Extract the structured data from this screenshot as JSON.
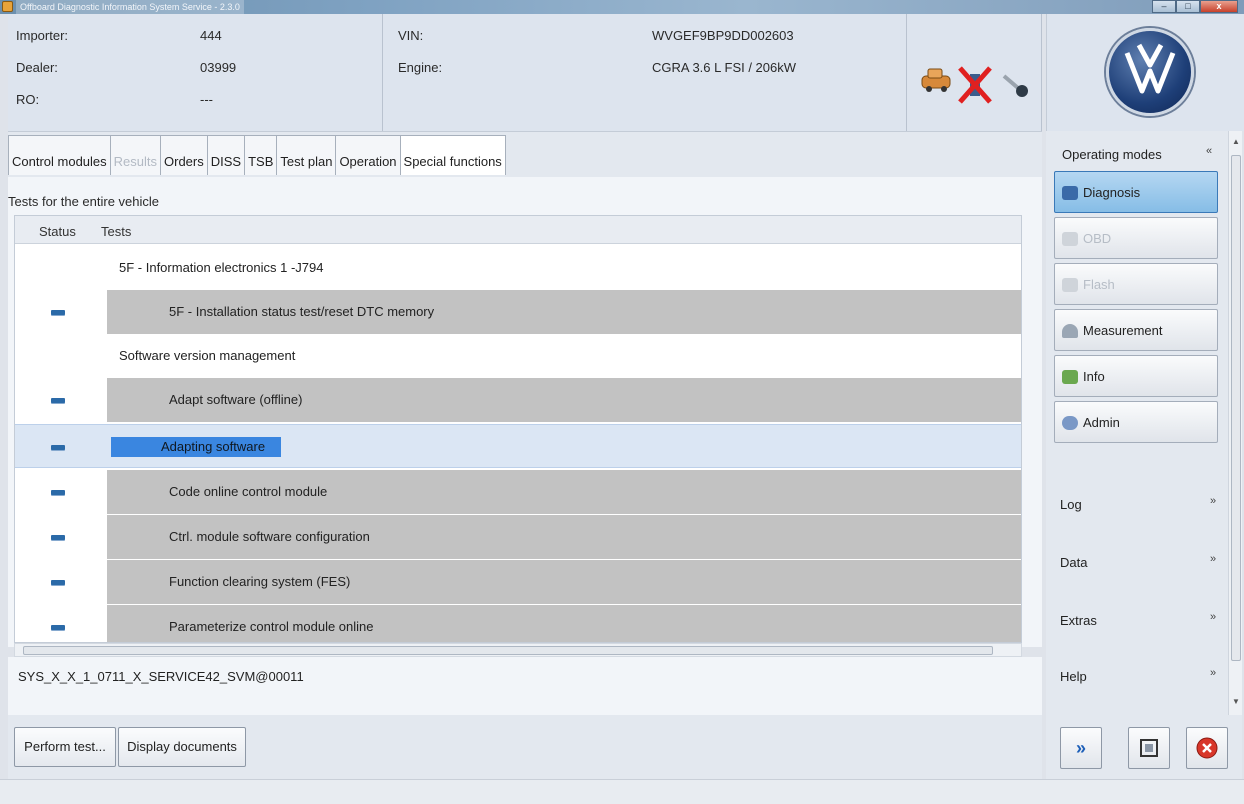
{
  "window": {
    "title": "Offboard Diagnostic Information System Service - 2.3.0",
    "minimize": "–",
    "maximize": "□",
    "close": "x"
  },
  "header": {
    "importer_label": "Importer:",
    "importer_value": "444",
    "dealer_label": "Dealer:",
    "dealer_value": "03999",
    "ro_label": "RO:",
    "ro_value": "---",
    "vin_label": "VIN:",
    "vin_value": "WVGEF9BP9DD002603",
    "engine_label": "Engine:",
    "engine_value": "CGRA 3.6 L FSI / 206kW"
  },
  "tabs": [
    {
      "label": "Control modules"
    },
    {
      "label": "Results"
    },
    {
      "label": "Orders"
    },
    {
      "label": "DISS"
    },
    {
      "label": "TSB"
    },
    {
      "label": "Test plan"
    },
    {
      "label": "Operation"
    },
    {
      "label": "Special functions"
    }
  ],
  "main": {
    "section_title": "Tests for the entire vehicle",
    "col_status": "Status",
    "col_tests": "Tests",
    "rows": [
      {
        "text": "5F - Information electronics 1 -J794"
      },
      {
        "text": "5F - Installation status test/reset DTC memory"
      },
      {
        "text": "Software version management"
      },
      {
        "text": "Adapt software (offline)"
      },
      {
        "text": "Adapting software"
      },
      {
        "text": "Code online control module"
      },
      {
        "text": "Ctrl. module software configuration"
      },
      {
        "text": "Function clearing system (FES)"
      },
      {
        "text": "Parameterize control module online"
      }
    ],
    "status_line": "SYS_X_X_1_0711_X_SERVICE42_SVM@00011"
  },
  "buttons": {
    "perform_test": "Perform test...",
    "display_documents": "Display documents"
  },
  "sidebar": {
    "heading": "Operating modes",
    "collapse": "«",
    "modes": [
      {
        "label": "Diagnosis"
      },
      {
        "label": "OBD"
      },
      {
        "label": "Flash"
      },
      {
        "label": "Measurement"
      },
      {
        "label": "Info"
      },
      {
        "label": "Admin"
      }
    ],
    "sections": [
      {
        "label": "Log",
        "chevron": "»"
      },
      {
        "label": "Data",
        "chevron": "»"
      },
      {
        "label": "Extras",
        "chevron": "»"
      },
      {
        "label": "Help",
        "chevron": "»"
      }
    ]
  },
  "nav": {
    "forward": "»"
  },
  "colors": {
    "active_mode": "#86bde6",
    "selection": "#3a86e0",
    "status_indicator": "#2b6aa8",
    "row_gray": "#c2c2c2"
  },
  "icons": [
    "car-icon",
    "no-connection-icon",
    "key-icon",
    "vw-logo",
    "forward-icon",
    "screenshot-icon",
    "exit-icon"
  ]
}
